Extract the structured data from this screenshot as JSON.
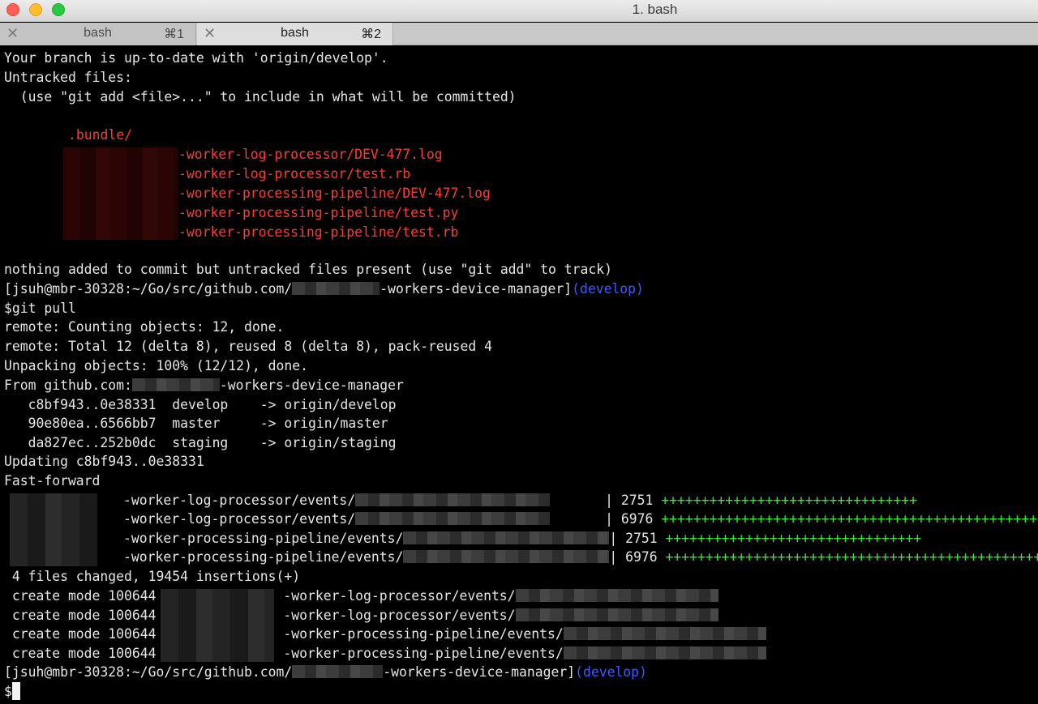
{
  "window": {
    "title": "1. bash"
  },
  "tabs": [
    {
      "label": "bash",
      "shortcut": "⌘1"
    },
    {
      "label": "bash",
      "shortcut": "⌘2"
    }
  ],
  "terminal": {
    "branch_status": "Your branch is up-to-date with 'origin/develop'.",
    "untracked_header": "Untracked files:",
    "untracked_hint": "  (use \"git add <file>...\" to include in what will be committed)",
    "untracked_files": [
      ".bundle/",
      "-worker-log-processor/DEV-477.log",
      "-worker-log-processor/test.rb",
      "-worker-processing-pipeline/DEV-477.log",
      "-worker-processing-pipeline/test.py",
      "-worker-processing-pipeline/test.rb"
    ],
    "nothing_added": "nothing added to commit but untracked files present (use \"git add\" to track)",
    "prompt_prefix": "[jsuh@mbr-30328:~/Go/src/github.com/",
    "prompt_suffix": "-workers-device-manager]",
    "prompt_branch": "(develop)",
    "command": "$git pull",
    "remote_counting": "remote: Counting objects: 12, done.",
    "remote_total": "remote: Total 12 (delta 8), reused 8 (delta 8), pack-reused 4",
    "unpacking": "Unpacking objects: 100% (12/12), done.",
    "from_prefix": "From github.com:",
    "from_suffix": "-workers-device-manager",
    "refs": [
      "   c8bf943..0e38331  develop    -> origin/develop",
      "   90e80ea..6566bb7  master     -> origin/master",
      "   da827ec..252b0dc  staging    -> origin/staging"
    ],
    "updating": "Updating c8bf943..0e38331",
    "fast_forward": "Fast-forward",
    "diffstat": [
      {
        "path": "-worker-log-processor/events/",
        "count": "| 2751",
        "plus": "++++++++++++++++++++++++++++++++"
      },
      {
        "path": "-worker-log-processor/events/",
        "count": "| 6976",
        "plus": "+++++++++++++++++++++++++++++++++++++++++++++++++"
      },
      {
        "path": "-worker-processing-pipeline/events/",
        "count": "| 2751",
        "plus": "++++++++++++++++++++++++++++++++"
      },
      {
        "path": "-worker-processing-pipeline/events/",
        "count": "| 6976",
        "plus": "+++++++++++++++++++++++++++++++++++++++++++++++++"
      }
    ],
    "summary": " 4 files changed, 19454 insertions(+)",
    "create_prefix": " create mode 100644 ",
    "create_paths": [
      "-worker-log-processor/events/",
      "-worker-log-processor/events/",
      "-worker-processing-pipeline/events/",
      "-worker-processing-pipeline/events/"
    ],
    "final_prompt": "$"
  }
}
